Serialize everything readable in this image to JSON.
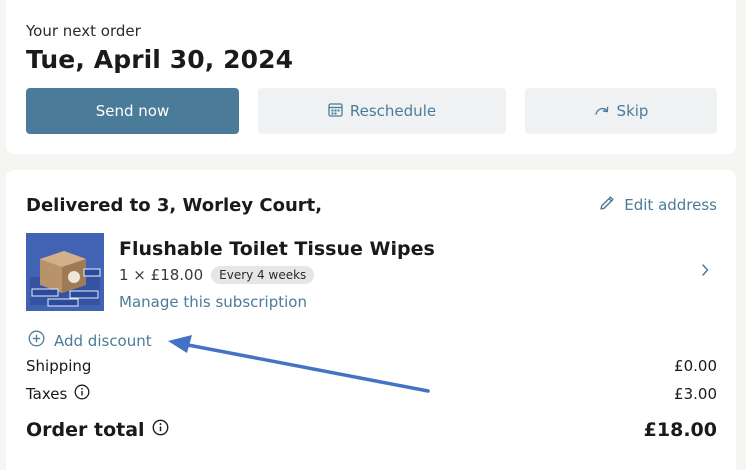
{
  "next_order": {
    "label": "Your next order",
    "date": "Tue, April 30, 2024",
    "send_now_label": "Send now",
    "reschedule_label": "Reschedule",
    "skip_label": "Skip"
  },
  "order": {
    "delivered_to": "Delivered to 3, Worley Court,",
    "edit_address_label": "Edit address",
    "product": {
      "title": "Flushable Toilet Tissue Wipes",
      "quantity_price": "1 × £18.00",
      "frequency": "Every 4 weeks",
      "manage_label": "Manage this subscription"
    },
    "add_discount_label": "Add discount",
    "shipping_label": "Shipping",
    "shipping_value": "£0.00",
    "taxes_label": "Taxes",
    "taxes_value": "£3.00",
    "total_label": "Order total",
    "total_value": "£18.00"
  },
  "colors": {
    "accent": "#4a7c99",
    "annotation_arrow": "#4472c4",
    "product_bg": "#4262b4"
  },
  "icons": {
    "reschedule": "calendar-icon",
    "skip": "redo-arrow-icon",
    "edit": "pencil-icon",
    "chevron": "chevron-right-icon",
    "discount": "plus-circle-icon",
    "info": "info-icon"
  }
}
